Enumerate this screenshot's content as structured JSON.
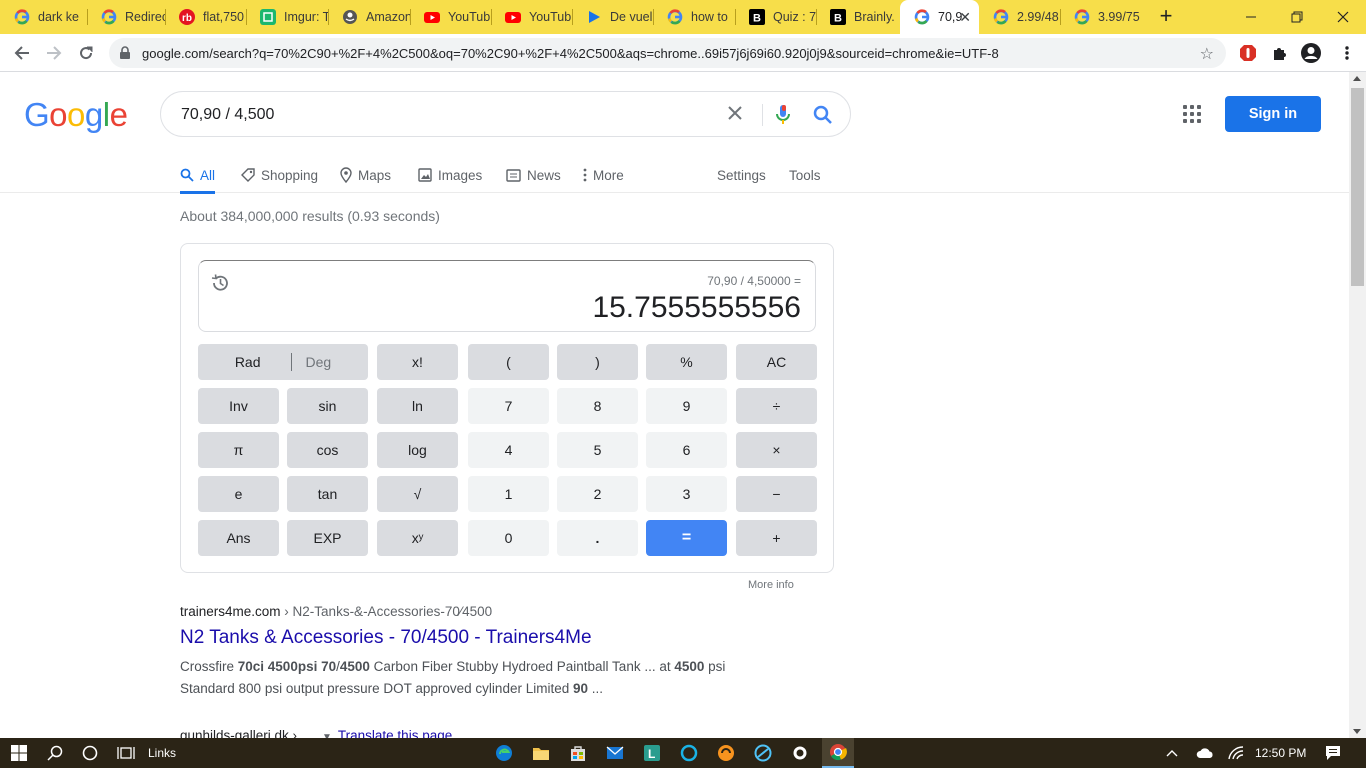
{
  "browser": {
    "tabs": [
      {
        "label": "dark ke",
        "favicon": "google-icon",
        "active": false
      },
      {
        "label": "Redirec",
        "favicon": "google-icon",
        "active": false
      },
      {
        "label": "flat,750",
        "favicon": "redbubble-icon",
        "active": false
      },
      {
        "label": "Imgur: T",
        "favicon": "imgur-icon",
        "active": false
      },
      {
        "label": "Amazon",
        "favicon": "amazon-icon",
        "active": false
      },
      {
        "label": "YouTub",
        "favicon": "youtube-icon",
        "active": false
      },
      {
        "label": "YouTub",
        "favicon": "youtube-icon",
        "active": false
      },
      {
        "label": "De vuel",
        "favicon": "play-icon",
        "active": false
      },
      {
        "label": "how to",
        "favicon": "google-icon",
        "active": false
      },
      {
        "label": "Quiz : 7",
        "favicon": "brainly-icon",
        "active": false
      },
      {
        "label": "Brainly.",
        "favicon": "brainly-icon",
        "active": false
      },
      {
        "label": "70,9",
        "favicon": "google-icon",
        "active": true
      },
      {
        "label": "2.99/48",
        "favicon": "google-icon",
        "active": false
      },
      {
        "label": "3.99/75",
        "favicon": "google-icon",
        "active": false
      }
    ],
    "url": "google.com/search?q=70%2C90+%2F+4%2C500&oq=70%2C90+%2F+4%2C500&aqs=chrome..69i57j6j69i60.920j0j9&sourceid=chrome&ie=UTF-8"
  },
  "google": {
    "query": "70,90 / 4,500",
    "signin_label": "Sign in",
    "tabs": [
      "All",
      "Shopping",
      "Maps",
      "Images",
      "News",
      "More"
    ],
    "settings_label": "Settings",
    "tools_label": "Tools",
    "stats": "About 384,000,000 results (0.93 seconds)"
  },
  "calculator": {
    "expression": "70,90 / 4,50000 =",
    "result": "15.7555555556",
    "rows": [
      [
        "Rad|Deg",
        "x!",
        "(",
        ")",
        "%",
        "AC"
      ],
      [
        "Inv",
        "sin",
        "ln",
        "7",
        "8",
        "9",
        "÷"
      ],
      [
        "π",
        "cos",
        "log",
        "4",
        "5",
        "6",
        "×"
      ],
      [
        "e",
        "tan",
        "√",
        "1",
        "2",
        "3",
        "−"
      ],
      [
        "Ans",
        "EXP",
        "xʸ",
        "0",
        ".",
        "=",
        "+"
      ]
    ],
    "rad_label": "Rad",
    "deg_label": "Deg",
    "more_info": "More info"
  },
  "results": [
    {
      "site": "trainers4me.com",
      "path": " › N2-Tanks-&-Accessories-70⁄4500",
      "title": "N2 Tanks & Accessories - 70/4500 - Trainers4Me",
      "snippet_html": "Crossfire <b>70ci 4500psi 70</b>/<b>4500</b> Carbon Fiber Stubby Hydroed Paintball Tank ... at <b>4500</b> psi Standard 800 psi output pressure DOT approved cylinder Limited <b>90</b> ..."
    }
  ],
  "second_result": {
    "site": "gunhilds-galleri.dk ›",
    "translate": "Translate this page"
  },
  "taskbar": {
    "links_label": "Links",
    "time": "12:50 PM"
  },
  "colors": {
    "tabstrip": "#f7de4a",
    "accent": "#1a73e8",
    "link": "#1a0dab",
    "equals": "#4285f4"
  }
}
